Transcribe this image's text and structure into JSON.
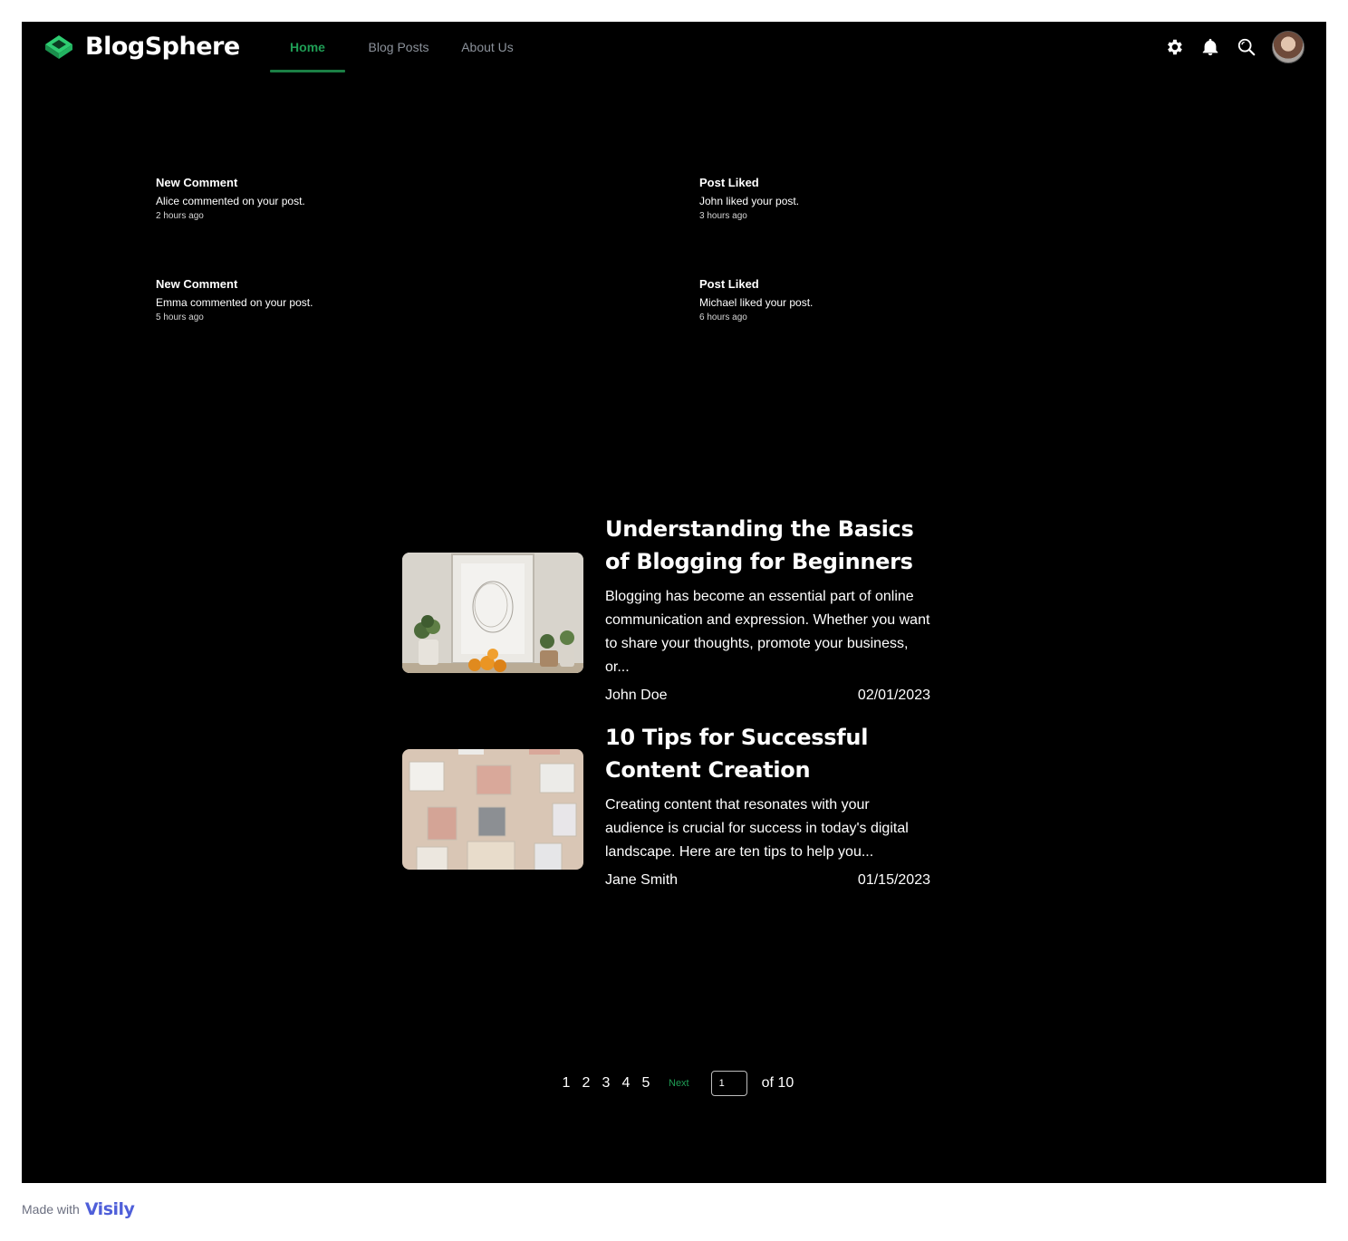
{
  "app": {
    "name": "BlogSphere",
    "accent": "#1f9d55"
  },
  "nav": {
    "tabs": [
      {
        "label": "Home",
        "active": true
      },
      {
        "label": "Blog Posts",
        "active": false
      },
      {
        "label": "About Us",
        "active": false
      }
    ]
  },
  "header_icons": [
    "gear-icon",
    "bell-icon",
    "search-icon",
    "avatar"
  ],
  "notifications": [
    {
      "title": "New Comment",
      "message": "Alice commented on your post.",
      "time": "2 hours ago"
    },
    {
      "title": "Post Liked",
      "message": "John liked your post.",
      "time": "3 hours ago"
    },
    {
      "title": "New Comment",
      "message": "Emma commented on your post.",
      "time": "5 hours ago"
    },
    {
      "title": "Post Liked",
      "message": "Michael liked your post.",
      "time": "6 hours ago"
    }
  ],
  "posts": [
    {
      "title": "Understanding the Basics of Blogging for Beginners",
      "excerpt": "Blogging has become an essential part of online communication and expression. Whether you want to share your thoughts, promote your business, or...",
      "author": "John Doe",
      "date": "02/01/2023"
    },
    {
      "title": "10 Tips for Successful Content Creation",
      "excerpt": "Creating content that resonates with your audience is crucial for success in today's digital landscape. Here are ten tips to help you...",
      "author": "Jane Smith",
      "date": "01/15/2023"
    }
  ],
  "pagination": {
    "pages": [
      "1",
      "2",
      "3",
      "4",
      "5"
    ],
    "next_label": "Next",
    "current_page": "1",
    "total_label": "of 10"
  },
  "footer": {
    "made_with": "Made with",
    "brand": "Visily"
  }
}
